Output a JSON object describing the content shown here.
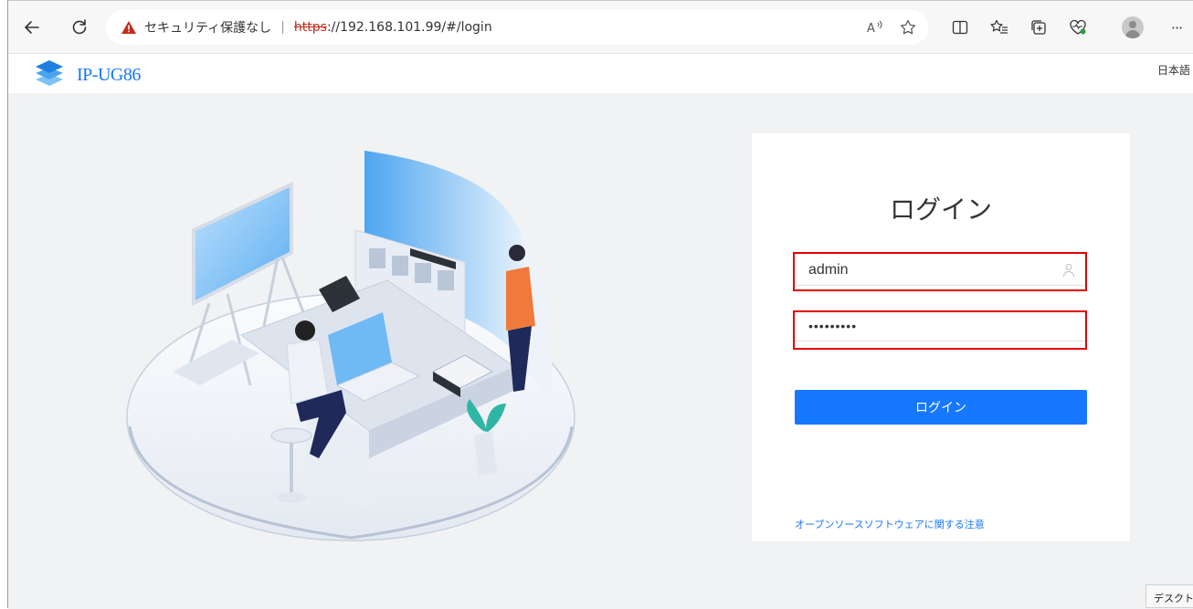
{
  "browser": {
    "security_label": "セキュリティ保護なし",
    "separator": "|",
    "url_scheme": "https",
    "url_rest": "://192.168.101.99/#/login",
    "more_label": "···",
    "icons": [
      "back-arrow-icon",
      "refresh-icon",
      "warning-icon",
      "read-aloud-icon",
      "favorite-star-icon",
      "split-screen-icon",
      "favorites-icon",
      "collections-icon",
      "browser-essentials-icon",
      "profile-avatar",
      "more-icon"
    ]
  },
  "app": {
    "title": "IP-UG86",
    "language": "日本語"
  },
  "login": {
    "heading": "ログイン",
    "username_value": "admin",
    "password_value": "•••••••••",
    "button_label": "ログイン",
    "oss_notice": "オープンソースソフトウェアに関する注意"
  },
  "taskbar": {
    "desktop_label": "デスクトップ"
  },
  "colors": {
    "accent": "#1677ff",
    "highlight": "#e30000",
    "background": "#f1f2f4",
    "warning": "#c42b1c"
  }
}
